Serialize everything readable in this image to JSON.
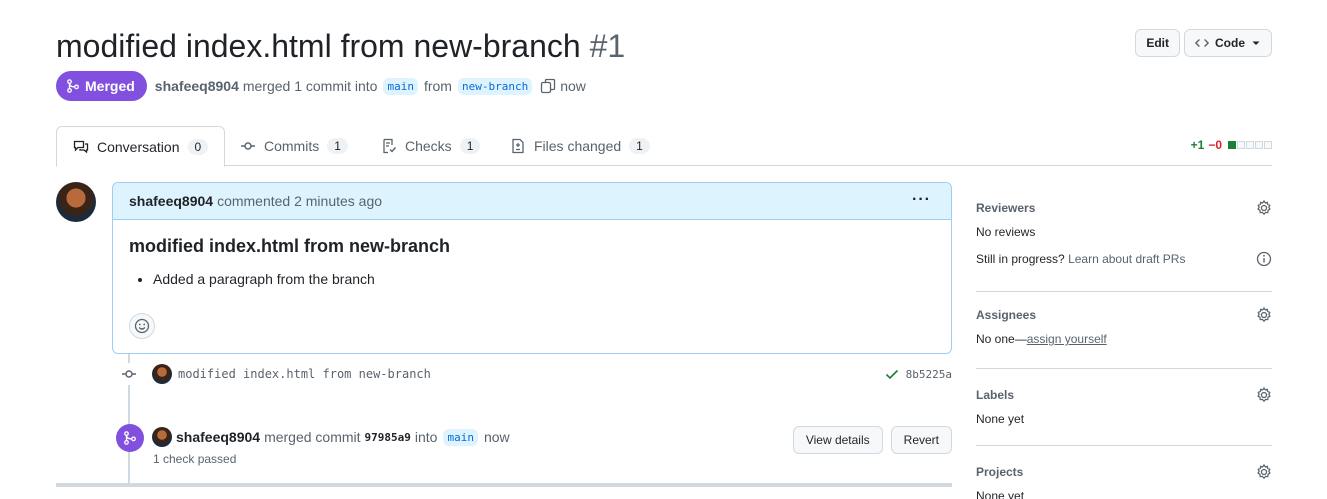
{
  "header": {
    "title": "modified index.html from new-branch",
    "number": "#1",
    "edit_label": "Edit",
    "code_label": "Code"
  },
  "meta": {
    "state": "Merged",
    "author": "shafeeq8904",
    "action": "merged 1 commit into",
    "base_branch": "main",
    "from": "from",
    "head_branch": "new-branch",
    "time": "now"
  },
  "tabs": [
    {
      "label": "Conversation",
      "count": "0",
      "icon": "comment-discussion-icon"
    },
    {
      "label": "Commits",
      "count": "1",
      "icon": "git-commit-icon"
    },
    {
      "label": "Checks",
      "count": "1",
      "icon": "checklist-icon"
    },
    {
      "label": "Files changed",
      "count": "1",
      "icon": "file-diff-icon"
    }
  ],
  "diffstat": {
    "additions": "+1",
    "deletions": "−0"
  },
  "comment": {
    "author": "shafeeq8904",
    "meta": "commented 2 minutes ago",
    "heading": "modified index.html from new-branch",
    "bullets": [
      "Added a paragraph from the branch"
    ]
  },
  "commit": {
    "message": "modified index.html from new-branch",
    "sha": "8b5225a"
  },
  "merge_event": {
    "author": "shafeeq8904",
    "action": "merged commit",
    "sha": "97985a9",
    "into": "into",
    "branch": "main",
    "time": "now",
    "checks": "1 check passed",
    "view_details_label": "View details",
    "revert_label": "Revert"
  },
  "sidebar": {
    "reviewers_title": "Reviewers",
    "reviewers_value": "No reviews",
    "draft_text": "Still in progress?",
    "draft_link": "Learn about draft PRs",
    "assignees_title": "Assignees",
    "assignees_prefix": "No one—",
    "assignees_link": "assign yourself",
    "labels_title": "Labels",
    "labels_value": "None yet",
    "projects_title": "Projects",
    "projects_value": "None yet"
  },
  "colors": {
    "merged": "#8250df",
    "accent": "#0969da",
    "comment_header": "#ddf4ff",
    "success": "#1a7f37"
  }
}
